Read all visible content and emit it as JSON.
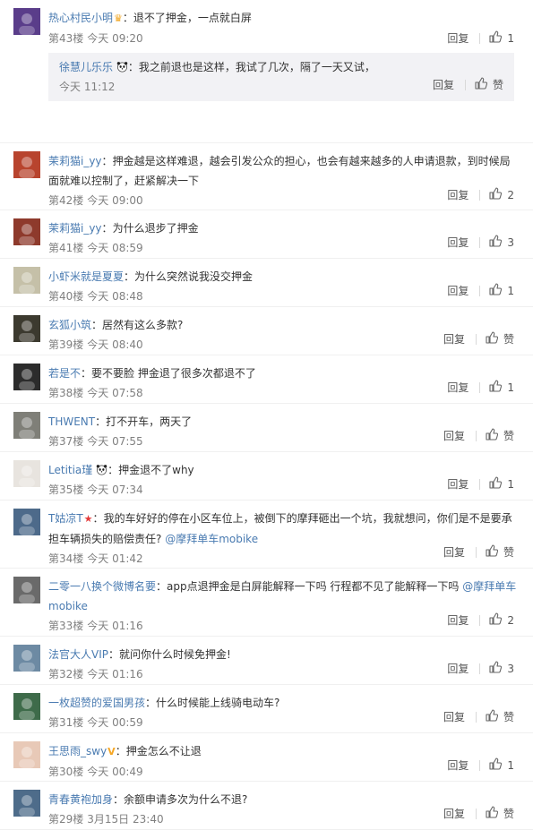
{
  "action_labels": {
    "reply": "回复",
    "like_zero": "赞"
  },
  "colors": {
    "username": "#4a7bb1",
    "meta": "#808080",
    "background": "#ffffff",
    "subreply_bg": "#f2f2f5"
  },
  "comments": [
    {
      "user": "热心村民小明",
      "badge": "crown",
      "text": "退不了押金，一点就白屏",
      "floor": "第43楼",
      "time": "今天 09:20",
      "likes": "1",
      "subreply": {
        "user": "徐慧儿乐乐",
        "emoji": "panda",
        "text": "我之前退也是这样，我试了几次，隔了一天又试，",
        "time": "今天 11:12",
        "likes": "赞"
      }
    },
    {
      "user": "茉莉猫i_yy",
      "text": "押金越是这样难退，越会引发公众的担心，也会有越来越多的人申请退款，到时候局面就难以控制了，赶紧解决一下",
      "floor": "第42楼",
      "time": "今天 09:00",
      "likes": "2"
    },
    {
      "user": "茉莉猫i_yy",
      "text": "为什么退步了押金",
      "floor": "第41楼",
      "time": "今天 08:59",
      "likes": "3"
    },
    {
      "user": "小虾米就是夏夏",
      "text": "为什么突然说我没交押金",
      "floor": "第40楼",
      "time": "今天 08:48",
      "likes": "1"
    },
    {
      "user": "玄狐小筑",
      "text": "居然有这么多款?",
      "floor": "第39楼",
      "time": "今天 08:40",
      "likes": "赞"
    },
    {
      "user": "若是不",
      "text": "要不要脸 押金退了很多次都退不了",
      "floor": "第38楼",
      "time": "今天 07:58",
      "likes": "1"
    },
    {
      "user": "THWENT",
      "text": "打不开车，两天了",
      "floor": "第37楼",
      "time": "今天 07:55",
      "likes": "赞"
    },
    {
      "user": "Letitia瑾",
      "emoji": "panda",
      "text": "押金退不了why",
      "floor": "第35楼",
      "time": "今天 07:34",
      "likes": "1"
    },
    {
      "user": "T姑凉T",
      "badge": "star",
      "text": "我的车好好的停在小区车位上，被倒下的摩拜砸出一个坑，我就想问，你们是不是要承担车辆损失的赔偿责任?",
      "mention": "@摩拜单车mobike",
      "floor": "第34楼",
      "time": "今天 01:42",
      "likes": "赞"
    },
    {
      "user": "二零一八换个微博名要",
      "text": "app点退押金是白屏能解释一下吗 行程都不见了能解释一下吗",
      "mention": "@摩拜单车mobike",
      "floor": "第33楼",
      "time": "今天 01:16",
      "likes": "2"
    },
    {
      "user": "法官大人VIP",
      "text": "就问你什么时候免押金!",
      "floor": "第32楼",
      "time": "今天 01:16",
      "likes": "3"
    },
    {
      "user": "一枚超赞的爱国男孩",
      "text": "什么时候能上线骑电动车?",
      "floor": "第31楼",
      "time": "今天 00:59",
      "likes": "赞"
    },
    {
      "user": "王思雨_swy",
      "badge": "v",
      "text": "押金怎么不让退",
      "floor": "第30楼",
      "time": "今天 00:49",
      "likes": "1"
    },
    {
      "user": "青春黄袍加身",
      "text": "余额申请多次为什么不退?",
      "floor": "第29楼",
      "time": "3月15日 23:40",
      "likes": "赞"
    }
  ]
}
